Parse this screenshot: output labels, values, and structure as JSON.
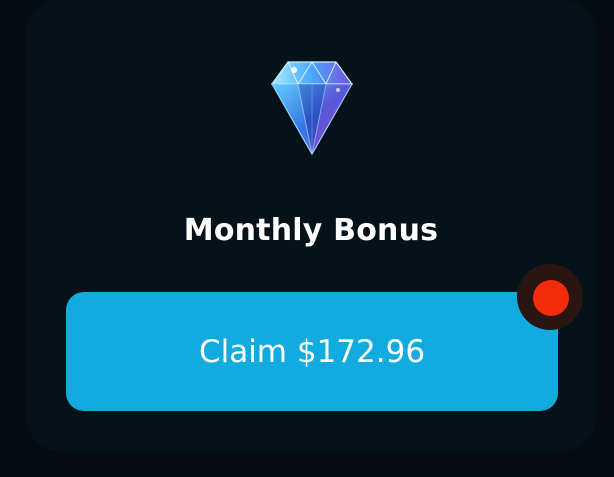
{
  "bonus": {
    "title": "Monthly Bonus",
    "claim_label": "Claim $172.96",
    "icon": "diamond-icon",
    "notification": "notification-dot"
  },
  "colors": {
    "background": "#050d12",
    "card": "#06121a",
    "button": "#12abe0",
    "notification": "#f52c0c",
    "text": "#ffffff"
  }
}
